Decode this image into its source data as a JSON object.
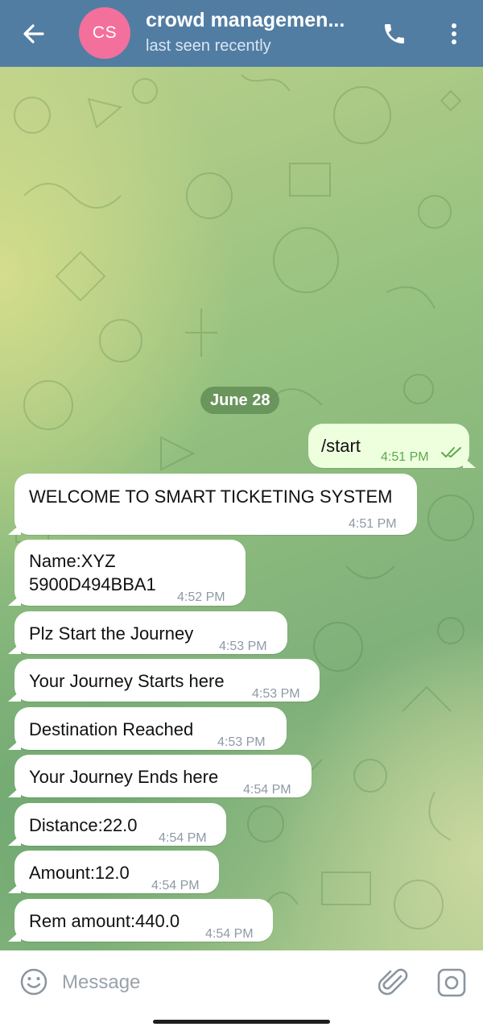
{
  "header": {
    "avatar_initials": "CS",
    "avatar_color": "#f2709b",
    "title": "crowd managemen...",
    "status": "last seen recently",
    "bar_color": "#527da3",
    "icons": [
      "back-arrow-icon",
      "phone-icon",
      "more-vertical-icon"
    ]
  },
  "chat": {
    "date_separator": "June 28",
    "messages": [
      {
        "direction": "out",
        "text": "/start",
        "time": "4:51 PM",
        "read": true
      },
      {
        "direction": "in",
        "text": "WELCOME TO SMART TICKETING SYSTEM",
        "time": "4:51 PM"
      },
      {
        "direction": "in",
        "text": "Name:XYZ\n5900D494BBA1",
        "time": "4:52 PM"
      },
      {
        "direction": "in",
        "text": "Plz Start the Journey",
        "time": "4:53 PM"
      },
      {
        "direction": "in",
        "text": "Your Journey Starts here",
        "time": "4:53 PM"
      },
      {
        "direction": "in",
        "text": "Destination Reached",
        "time": "4:53 PM"
      },
      {
        "direction": "in",
        "text": "Your Journey Ends here",
        "time": "4:54 PM"
      },
      {
        "direction": "in",
        "text": "Distance:22.0",
        "time": "4:54 PM"
      },
      {
        "direction": "in",
        "text": "Amount:12.0",
        "time": "4:54 PM"
      },
      {
        "direction": "in",
        "text": "Rem amount:440.0",
        "time": "4:54 PM"
      }
    ]
  },
  "composer": {
    "placeholder": "Message",
    "icons": [
      "emoji-icon",
      "attach-icon",
      "camera-icon"
    ]
  }
}
